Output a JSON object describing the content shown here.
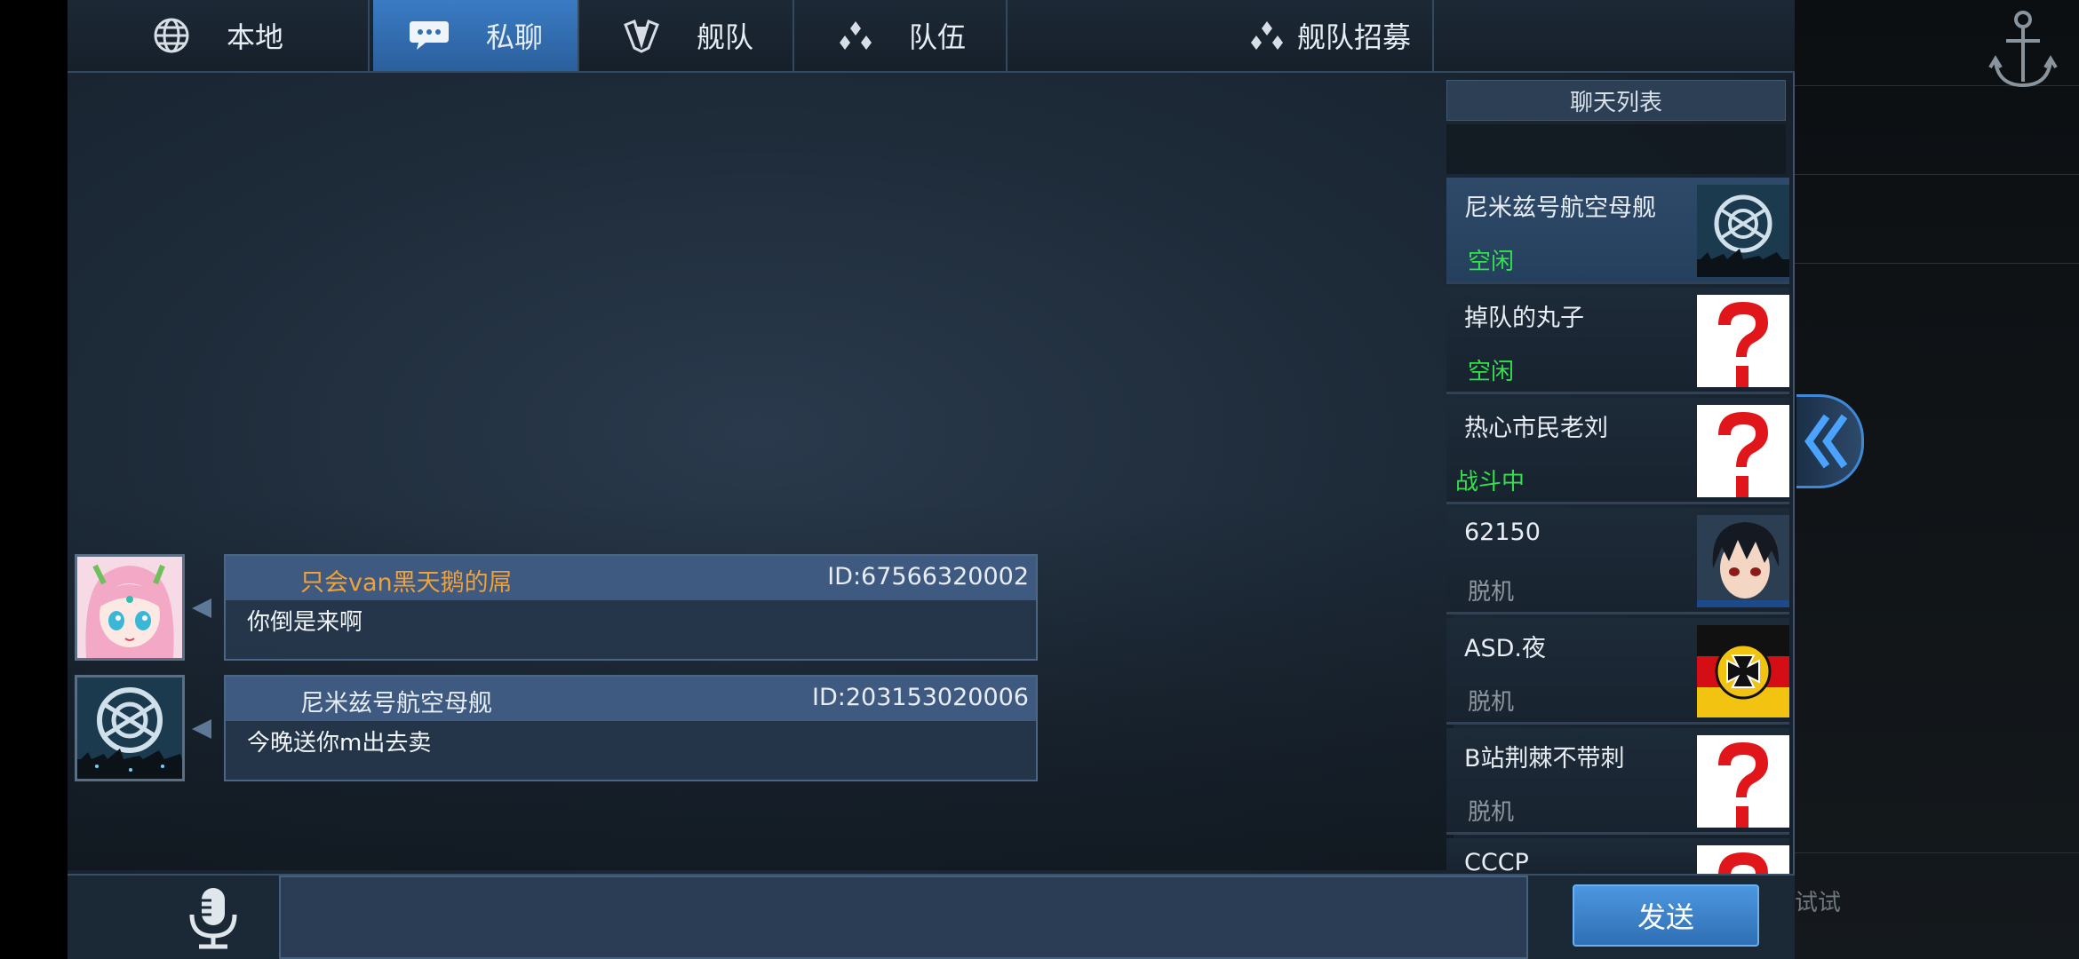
{
  "tabs": [
    {
      "label": "本地",
      "icon": "globe-icon"
    },
    {
      "label": "私聊",
      "icon": "speech-bubble-icon"
    },
    {
      "label": "舰队",
      "icon": "fleet-emblem-icon"
    },
    {
      "label": "队伍",
      "icon": "team-icon"
    },
    {
      "label": "舰队招募",
      "icon": "recruit-icon"
    }
  ],
  "messages": [
    {
      "name": "只会van黑天鹅的屌",
      "name_color": "#f0a13a",
      "id_text": "ID:67566320002",
      "text": "你倒是来啊",
      "avatar": "anime-girl-avatar"
    },
    {
      "name": "尼米兹号航空母舰",
      "name_color": "#e6edf3",
      "id_text": "ID:203153020006",
      "text": "今晚送你m出去卖",
      "avatar": "carrier-emblem-avatar"
    }
  ],
  "chat_list": {
    "title": "聊天列表",
    "contacts": [
      {
        "name": "尼米兹号航空母舰",
        "status": "空闲",
        "status_color": "#35e04c",
        "avatar": "carrier-emblem-avatar",
        "active": true
      },
      {
        "name": "掉队的丸子",
        "status": "空闲",
        "status_color": "#35e04c",
        "avatar": "question-mark-avatar",
        "active": false
      },
      {
        "name": "热心市民老刘",
        "status": "战斗中",
        "status_color": "#35e04c",
        "avatar": "question-mark-avatar",
        "active": false
      },
      {
        "name": "62150",
        "status": "脱机",
        "status_color": "#8e979f",
        "avatar": "anime-boy-avatar",
        "active": false
      },
      {
        "name": "ASD.夜",
        "status": "脱机",
        "status_color": "#8e979f",
        "avatar": "iron-cross-flag-avatar",
        "active": false
      },
      {
        "name": "B站荆棘不带刺",
        "status": "脱机",
        "status_color": "#8e979f",
        "avatar": "question-mark-avatar",
        "active": false
      },
      {
        "name": "CCCP",
        "status": "",
        "status_color": "#8e979f",
        "avatar": "question-mark-avatar",
        "active": false
      }
    ]
  },
  "input": {
    "value": "",
    "placeholder": ""
  },
  "send_label": "发送",
  "right_hint": "试试"
}
